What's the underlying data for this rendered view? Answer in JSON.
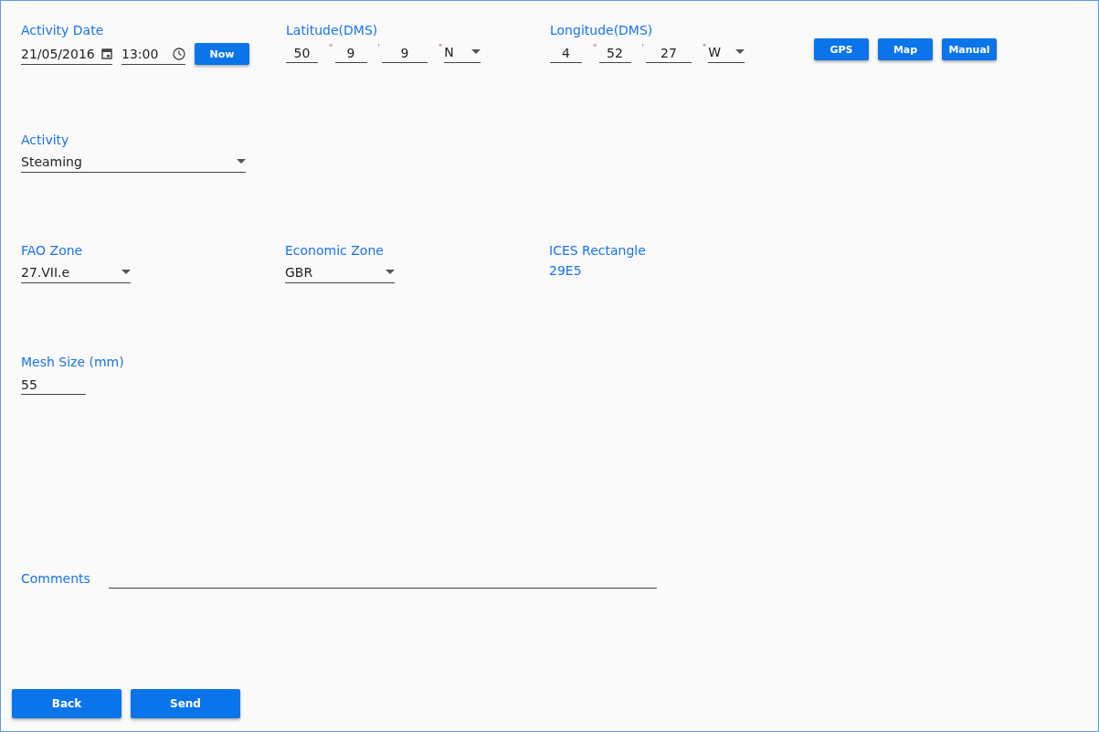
{
  "header": {
    "date": {
      "label": "Activity Date",
      "date": "21/05/2016",
      "time": "13:00",
      "button": "Now"
    },
    "latitude": {
      "label": "Latitude(DMS)",
      "parts": [
        {
          "value": "50",
          "unit": "°"
        },
        {
          "value": "9",
          "unit": "'"
        },
        {
          "value": "9",
          "unit": "\""
        }
      ],
      "hemisphere": "N"
    },
    "longitude": {
      "label": "Longitude(DMS)",
      "parts": [
        {
          "value": "4",
          "unit": "°"
        },
        {
          "value": "52",
          "unit": "'"
        },
        {
          "value": "27",
          "unit": "\""
        }
      ],
      "hemisphere": "W"
    },
    "location_buttons": [
      "GPS",
      "Map",
      "Manual"
    ]
  },
  "activity": {
    "label": "Activity",
    "value": "Steaming"
  },
  "zones": [
    {
      "label": "FAO Zone",
      "value": "27.VII.e",
      "kind": "dropdown"
    },
    {
      "label": "Economic Zone",
      "value": "GBR",
      "kind": "dropdown"
    },
    {
      "label": "ICES Rectangle",
      "value": "29E5",
      "kind": "text"
    }
  ],
  "mesh_size": {
    "label": "Mesh Size (mm)",
    "value": "55"
  },
  "comments": {
    "label": "Comments"
  },
  "buttons": [
    "Back",
    "Send"
  ]
}
